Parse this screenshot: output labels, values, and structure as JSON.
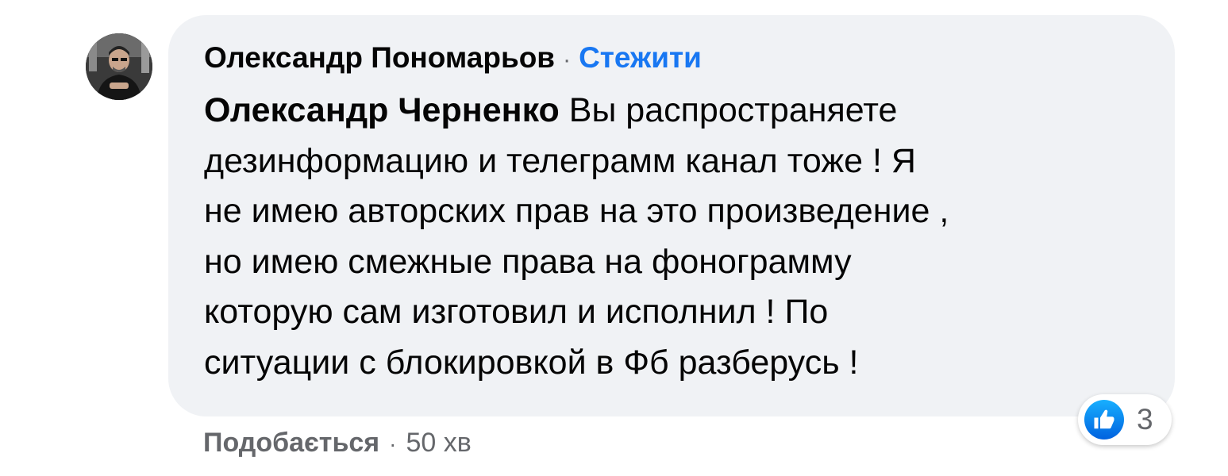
{
  "comment": {
    "author": "Олександр Пономарьов",
    "separator": "·",
    "follow_label": "Стежити",
    "mention": "Олександр Черненко",
    "text": " Вы распространяете\nдезинформацию и телеграмм канал тоже ! Я\nне имею авторских прав на это произведение ,\nно имею смежные права на фонограмму\nкоторую сам изготовил и исполнил ! По\nситуации с блокировкой в Фб разберусь !"
  },
  "reactions": {
    "icon": "like-icon",
    "count": "3"
  },
  "footer": {
    "like_label": "Подобається",
    "separator": "·",
    "time": "50 хв"
  },
  "colors": {
    "bubble": "#f0f2f5",
    "link": "#1877f2",
    "secondary_text": "#65676b",
    "primary_text": "#050505"
  }
}
